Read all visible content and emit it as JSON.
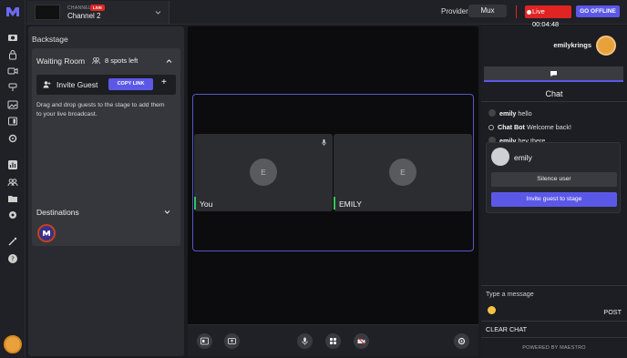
{
  "topbar": {
    "channel_label": "CHANNEL",
    "live_badge": "LIVE",
    "channel_name": "Channel 2",
    "provider_label": "Provider",
    "provider_value": "Mux",
    "live_timer": "Live 00:04:48",
    "go_offline": "GO OFFLINE"
  },
  "backstage": {
    "title": "Backstage",
    "waiting_room": {
      "title": "Waiting Room",
      "spots": "8 spots left",
      "invite_label": "Invite Guest",
      "copy_link": "COPY LINK",
      "plus": "+",
      "hint": "Drag and drop guests to the stage to add them to your live broadcast."
    },
    "destinations": {
      "title": "Destinations"
    }
  },
  "stage": {
    "tiles": [
      {
        "initial": "E",
        "name": "You"
      },
      {
        "initial": "E",
        "name": "EMILY"
      }
    ]
  },
  "chat": {
    "username": "emilykrings",
    "title": "Chat",
    "messages": [
      {
        "user": "emily",
        "text": "hello"
      },
      {
        "user": "Chat Bot",
        "text": "Welcome back!"
      },
      {
        "user": "emily",
        "text": "hey there"
      }
    ],
    "popup": {
      "name": "emily",
      "silence": "Silence user",
      "invite": "Invite guest to stage"
    },
    "input_placeholder": "Type a message",
    "post": "POST",
    "clear": "CLEAR CHAT",
    "powered_by": "POWERED BY MAESTRO"
  },
  "colors": {
    "accent": "#5b58e8",
    "live": "#e02424",
    "speaking": "#34c759"
  }
}
